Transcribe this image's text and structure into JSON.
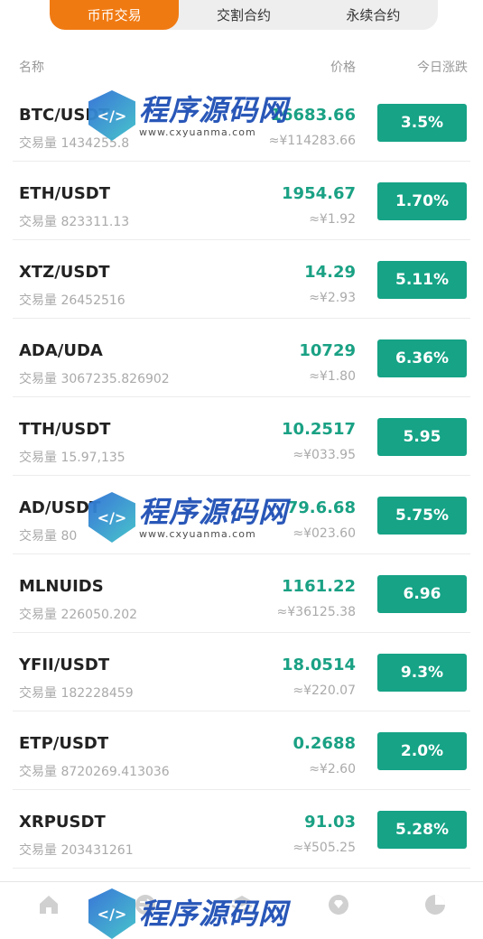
{
  "tabs": [
    "币币交易",
    "交割合约",
    "永续合约"
  ],
  "headers": {
    "name": "名称",
    "price": "价格",
    "change": "今日涨跌"
  },
  "rows": [
    {
      "pair": "BTC/USDT",
      "volume": "交易量 1434255.8",
      "price": "16683.66",
      "cny": "≈¥114283.66",
      "change": "3.5%"
    },
    {
      "pair": "ETH/USDT",
      "volume": "交易量 823311.13",
      "price": "1954.67",
      "cny": "≈¥1.92",
      "change": "1.70%"
    },
    {
      "pair": "XTZ/USDT",
      "volume": "交易量 26452516",
      "price": "14.29",
      "cny": "≈¥2.93",
      "change": "5.11%"
    },
    {
      "pair": "ADA/UDA",
      "volume": "交易量 3067235.826902",
      "price": "10729",
      "cny": "≈¥1.80",
      "change": "6.36%"
    },
    {
      "pair": "TTH/USDT",
      "volume": "交易量 15.97,135",
      "price": "10.2517",
      "cny": "≈¥033.95",
      "change": "5.95"
    },
    {
      "pair": "AD/USDT",
      "volume": "交易量 80",
      "price": "79.6.68",
      "cny": "≈¥023.60",
      "change": "5.75%"
    },
    {
      "pair": "MLNUIDS",
      "volume": "交易量 226050.202",
      "price": "1161.22",
      "cny": "≈¥36125.38",
      "change": "6.96"
    },
    {
      "pair": "YFII/USDT",
      "volume": "交易量 182228459",
      "price": "18.0514",
      "cny": "≈¥220.07",
      "change": "9.3%"
    },
    {
      "pair": "ETP/USDT",
      "volume": "交易量 8720269.413036",
      "price": "0.2688",
      "cny": "≈¥2.60",
      "change": "2.0%"
    },
    {
      "pair": "XRPUSDT",
      "volume": "交易量 203431261",
      "price": "91.03",
      "cny": "≈¥505.25",
      "change": "5.28%"
    }
  ],
  "watermark": {
    "title": "程序源码网",
    "url": "www.cxyuanma.com"
  },
  "colors": {
    "accent": "#f07a12",
    "green": "#16a386"
  },
  "footer_icons": [
    "home-icon",
    "exchange-icon",
    "layers-icon",
    "diamond-icon",
    "pie-chart-icon"
  ]
}
